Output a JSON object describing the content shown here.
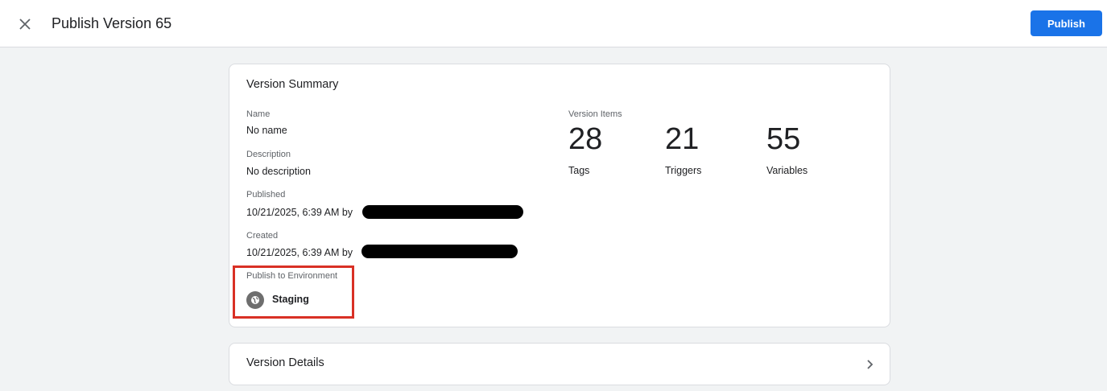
{
  "header": {
    "title": "Publish Version 65",
    "publish_label": "Publish"
  },
  "summary": {
    "title": "Version Summary",
    "name_label": "Name",
    "name_value": "No name",
    "description_label": "Description",
    "description_value": "No description",
    "published_label": "Published",
    "published_value": "10/21/2025, 6:39 AM by",
    "created_label": "Created",
    "created_value": "10/21/2025, 6:39 AM by",
    "environment_label": "Publish to Environment",
    "environment_value": "Staging",
    "environment_icon": "globe-icon"
  },
  "version_items": {
    "label": "Version Items",
    "stats": [
      {
        "count": "28",
        "label": "Tags"
      },
      {
        "count": "21",
        "label": "Triggers"
      },
      {
        "count": "55",
        "label": "Variables"
      }
    ]
  },
  "details": {
    "title": "Version Details"
  },
  "colors": {
    "primary": "#1a73e8",
    "highlight_border": "#d93025",
    "background": "#f1f3f4"
  }
}
